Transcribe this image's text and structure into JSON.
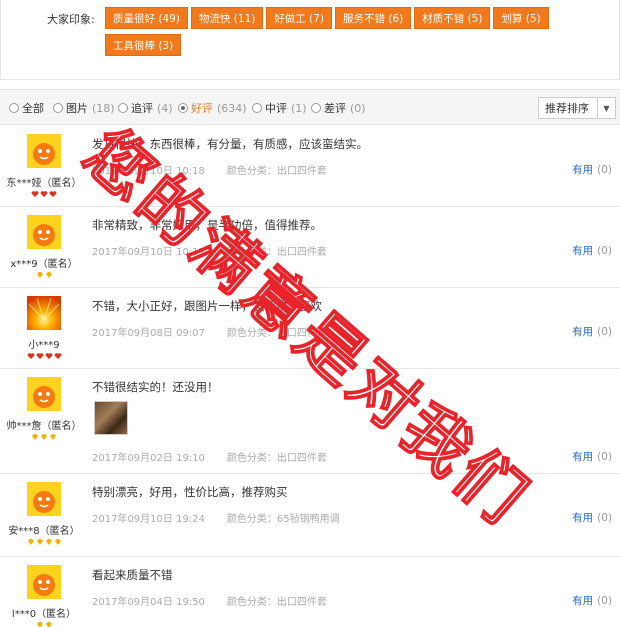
{
  "impression": {
    "label": "大家印象:",
    "tags": [
      "质量很好 (49)",
      "物流快 (11)",
      "好做工 (7)",
      "服务不错 (6)",
      "材质不错 (5)",
      "划算 (5)",
      "工具很棒 (3)"
    ]
  },
  "filters": [
    {
      "label": "全部",
      "count": ""
    },
    {
      "label": "图片",
      "count": "(18)"
    },
    {
      "label": "追评",
      "count": "(4)"
    },
    {
      "label": "好评",
      "count": "(634)"
    },
    {
      "label": "中评",
      "count": "(1)"
    },
    {
      "label": "差评",
      "count": "(0)"
    }
  ],
  "sort": {
    "label": "推荐排序",
    "arrow": "▼"
  },
  "reviews": [
    {
      "user": "东***娅（匿名）",
      "rank_color": "#e0301e",
      "text": "发货很快，东西很棒，有分量，有质感，应该蛮结实。",
      "date": "2017年09月10日 10:18",
      "spec": "颜色分类：出口四件套",
      "useful": "有用",
      "useful_count": "(0)"
    },
    {
      "user": "x***9（匿名）",
      "rank_color": "#f2b300",
      "text": "非常精致，非常好用，是半功倍，值得推荐。",
      "date": "2017年09月10日 10:17",
      "spec": "颜色分类：出口四件套",
      "useful": "有用",
      "useful_count": "(0)"
    },
    {
      "user": "小***9",
      "rank_color": "#e0301e",
      "text": "不错，大小正好，跟图片一样，发货快，喜欢",
      "date": "2017年09月08日 09:07",
      "spec": "颜色分类：出口四件套",
      "useful": "有用",
      "useful_count": "(0)"
    },
    {
      "user": "帅***詹（匿名）",
      "rank_color": "#f2b300",
      "text": "不错很结实的！还没用！",
      "date": "2017年09月02日 19:10",
      "spec": "颜色分类：出口四件套",
      "useful": "有用",
      "useful_count": "(0)"
    },
    {
      "user": "安***8（匿名）",
      "rank_color": "#f2b300",
      "text": "特别漂亮，好用，性价比高，推荐购买",
      "date": "2017年09月10日 19:24",
      "spec": "颜色分类：65毡钢鸭用调",
      "useful": "有用",
      "useful_count": "(0)"
    },
    {
      "user": "l***0（匿名）",
      "rank_color": "#f2b300",
      "text": "看起来质量不错",
      "date": "2017年09月04日 19:50",
      "spec": "颜色分类：出口四件套",
      "useful": "有用",
      "useful_count": "(0)"
    }
  ],
  "watermark": "您的满意是对我们",
  "colors": {
    "accent": "#f37a1c",
    "link": "#2b6cc4",
    "watermark": "#e8232a"
  }
}
